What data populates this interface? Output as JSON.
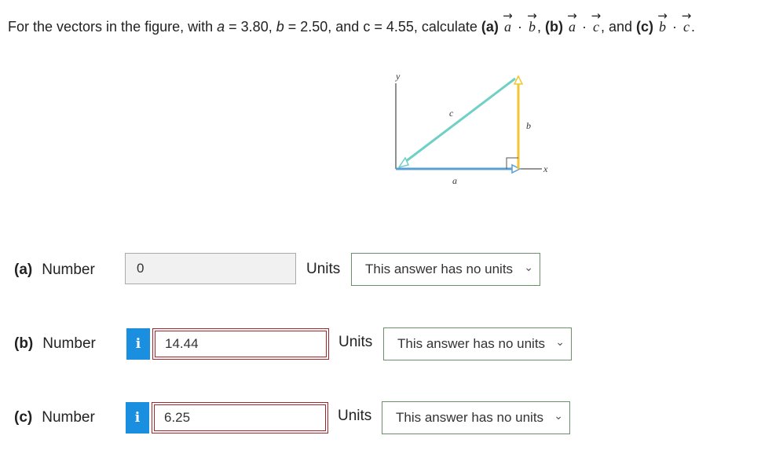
{
  "question": {
    "intro": "For the vectors in the figure, with",
    "a_var": "a",
    "a_val": " = 3.80, ",
    "b_var": "b",
    "b_val": " = 2.50, and c = 4.55, calculate ",
    "part_a": "(a)",
    "part_b": "(b)",
    "part_c": "(c)",
    "vec_a": "a",
    "vec_b": "b",
    "vec_c": "c",
    "dot": "·",
    "comma": ", ",
    "and_text": ", and ",
    "period": "."
  },
  "figure": {
    "y_axis_label": "y",
    "x_axis_label": "x",
    "label_a": "a",
    "label_b": "b",
    "label_c": "c",
    "colors": {
      "a": "#5a9fd4",
      "b": "#f5c531",
      "c": "#6fd0c6",
      "axes": "#555555"
    }
  },
  "answers": [
    {
      "part": "(a)",
      "label": "Number",
      "value": "0",
      "units_label": "Units",
      "units_value": "This answer has no units",
      "status": "neutral"
    },
    {
      "part": "(b)",
      "label": "Number",
      "value": "14.44",
      "units_label": "Units",
      "units_value": "This answer has no units",
      "status": "incorrect",
      "info_icon": "i"
    },
    {
      "part": "(c)",
      "label": "Number",
      "value": "6.25",
      "units_label": "Units",
      "units_value": "This answer has no units",
      "status": "incorrect",
      "info_icon": "i"
    }
  ],
  "chevron": "⌄"
}
